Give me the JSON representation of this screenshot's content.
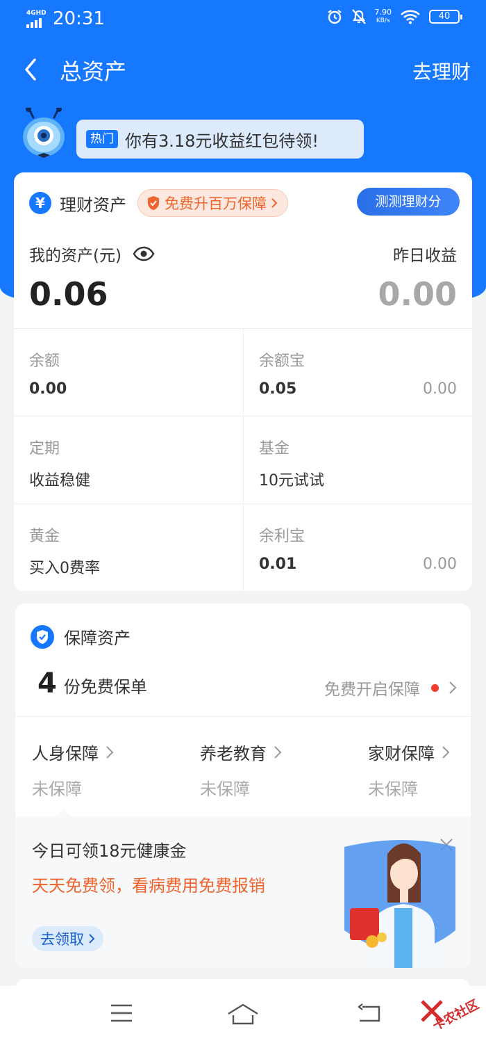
{
  "status_bar": {
    "network": "4GHD",
    "time": "20:31",
    "speed_value": "7.90",
    "speed_unit": "KB/s",
    "battery": "40"
  },
  "header": {
    "title": "总资产",
    "right_action": "去理财"
  },
  "banner": {
    "tag": "热门",
    "text": "你有3.18元收益红包待领!"
  },
  "wealth_card": {
    "title": "理财资产",
    "upgrade_label": "免费升百万保障",
    "test_button": "测测理财分",
    "assets_label": "我的资产(元)",
    "assets_value": "0.06",
    "yesterday_label": "昨日收益",
    "yesterday_value": "0.00",
    "items": [
      {
        "label": "余额",
        "value": "0.00",
        "sub": ""
      },
      {
        "label": "余额宝",
        "value": "0.05",
        "sub": "0.00"
      },
      {
        "label": "定期",
        "value": "收益稳健",
        "sub": ""
      },
      {
        "label": "基金",
        "value": "10元试试",
        "sub": ""
      },
      {
        "label": "黄金",
        "value": "买入0费率",
        "sub": ""
      },
      {
        "label": "余利宝",
        "value": "0.01",
        "sub": "0.00"
      }
    ]
  },
  "protection_card": {
    "title": "保障资产",
    "policy_count": "4",
    "policy_text": "份免费保单",
    "free_open": "免费开启保障",
    "categories": [
      {
        "name": "人身保障",
        "status": "未保障"
      },
      {
        "name": "养老教育",
        "status": "未保障"
      },
      {
        "name": "家财保障",
        "status": "未保障"
      }
    ],
    "promo": {
      "title": "今日可领18元健康金",
      "subtitle": "天天免费领，看病费用免费报销",
      "button": "去领取"
    }
  },
  "watermark": "卡农社区",
  "colors": {
    "primary": "#1677ff",
    "accent_orange": "#f0642d",
    "background": "#f2f3f5"
  },
  "icons": [
    "back-arrow-icon",
    "alarm-icon",
    "mute-bell-icon",
    "wifi-icon",
    "battery-icon",
    "mascot-icon",
    "yen-icon",
    "shield-icon",
    "eye-icon",
    "chevron-right-icon",
    "close-icon",
    "menu-icon",
    "home-icon",
    "return-icon"
  ]
}
